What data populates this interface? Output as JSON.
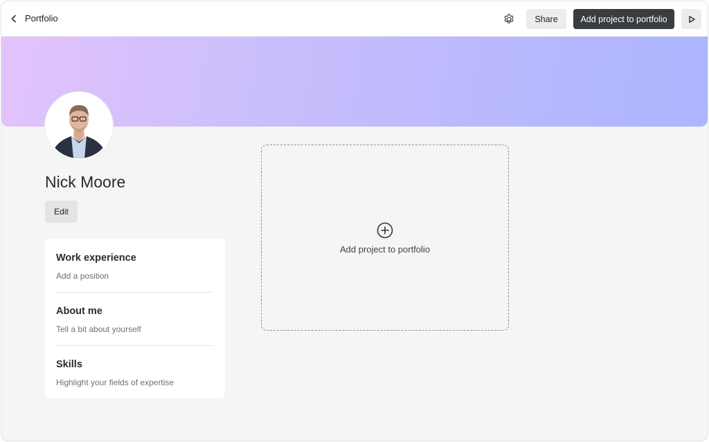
{
  "header": {
    "title": "Portfolio",
    "share_label": "Share",
    "add_project_label": "Add project to portfolio"
  },
  "icons": {
    "back": "chevron-left-icon",
    "settings": "gear-icon",
    "play": "play-icon",
    "add": "plus-circle-icon"
  },
  "colors": {
    "primary_button": "#3a3d40",
    "banner_start": "#e3c2fd",
    "banner_end": "#abb5fe",
    "background": "#f5f5f5"
  },
  "profile": {
    "name": "Nick Moore",
    "edit_label": "Edit"
  },
  "sections": [
    {
      "title": "Work experience",
      "subtitle": "Add a position"
    },
    {
      "title": "About me",
      "subtitle": "Tell a bit about yourself"
    },
    {
      "title": "Skills",
      "subtitle": "Highlight your fields of expertise"
    }
  ],
  "placeholder": {
    "label": "Add project to portfolio"
  }
}
